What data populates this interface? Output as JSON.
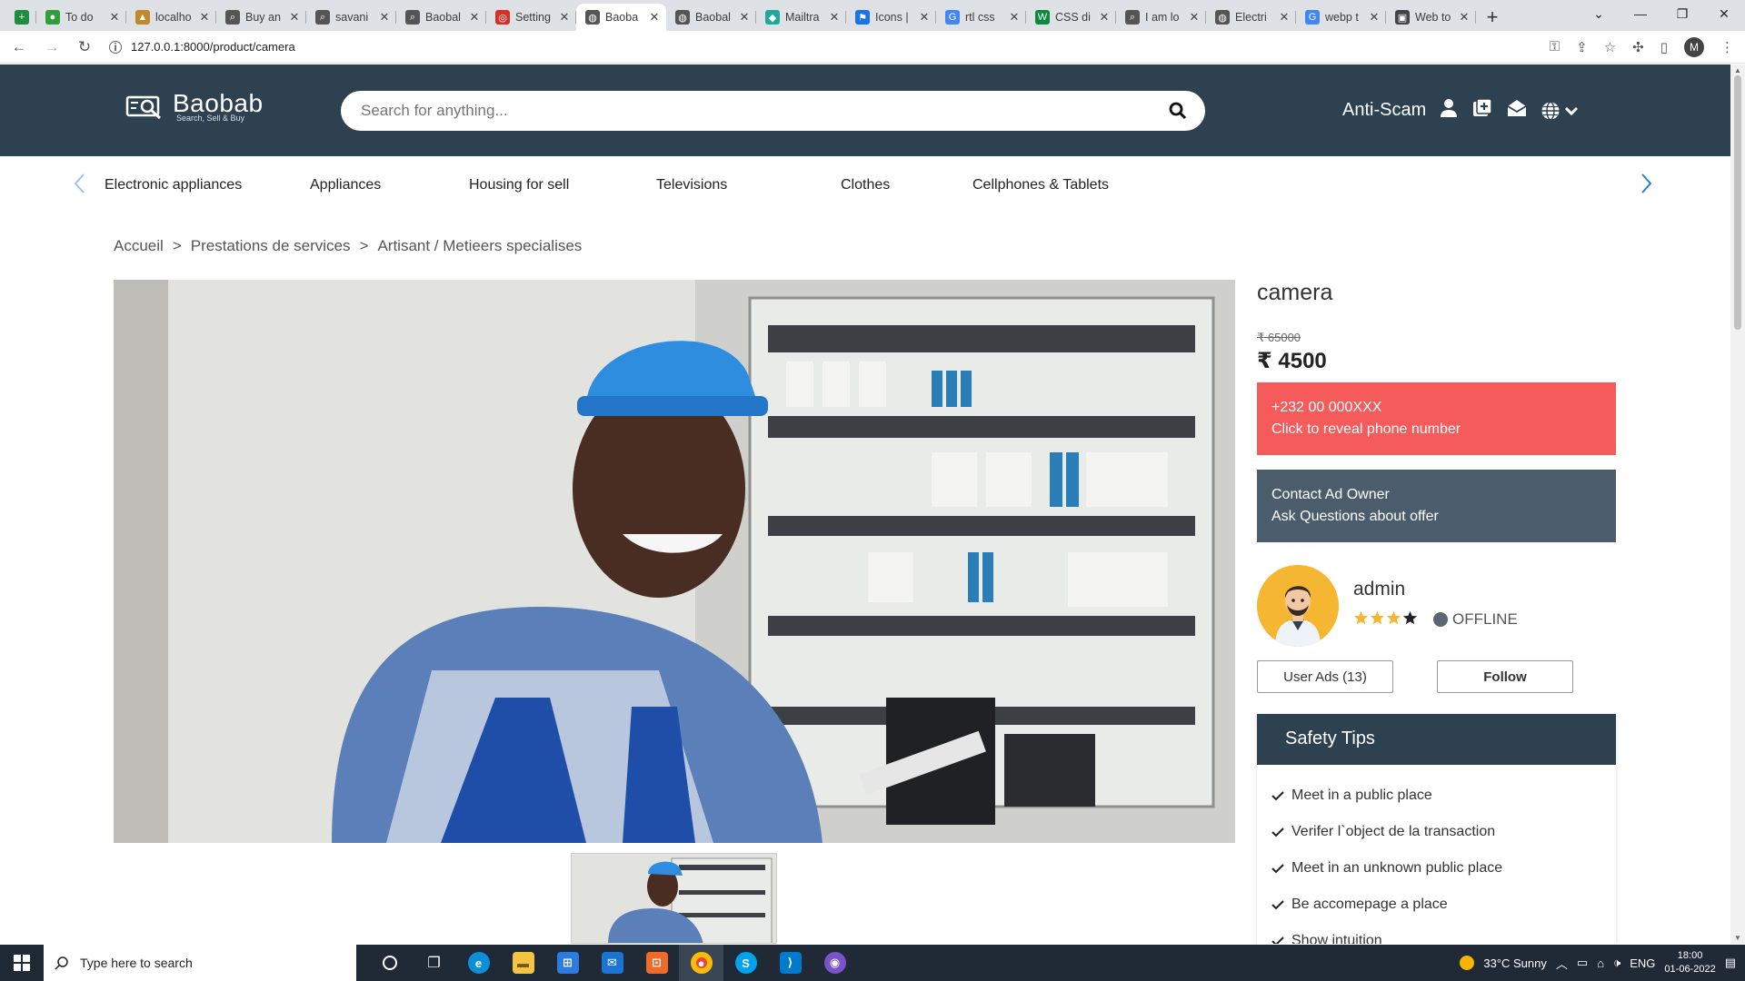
{
  "browser": {
    "tabs": [
      {
        "title": "",
        "favicon_color": "#1e8e3e",
        "favicon_glyph": "+",
        "favicon_name": "sheets-icon"
      },
      {
        "title": "To do",
        "favicon_color": "#2e9f3a",
        "favicon_glyph": "●",
        "favicon_name": "evernote-icon"
      },
      {
        "title": "localho",
        "favicon_color": "#c08a2a",
        "favicon_glyph": "▲",
        "favicon_name": "localhost-icon"
      },
      {
        "title": "Buy an",
        "favicon_color": "#555555",
        "favicon_glyph": "⌕",
        "favicon_name": "baobab-icon"
      },
      {
        "title": "savani",
        "favicon_color": "#555555",
        "favicon_glyph": "⌕",
        "favicon_name": "baobab-icon"
      },
      {
        "title": "Baobal",
        "favicon_color": "#555555",
        "favicon_glyph": "⌕",
        "favicon_name": "baobab-icon"
      },
      {
        "title": "Setting",
        "favicon_color": "#d93025",
        "favicon_glyph": "◎",
        "favicon_name": "settings-icon"
      },
      {
        "title": "Baoba",
        "favicon_color": "#555555",
        "favicon_glyph": "◍",
        "favicon_name": "globe-icon",
        "active": true
      },
      {
        "title": "Baobal",
        "favicon_color": "#555555",
        "favicon_glyph": "◍",
        "favicon_name": "globe-icon"
      },
      {
        "title": "Mailtra",
        "favicon_color": "#22a89a",
        "favicon_glyph": "◆",
        "favicon_name": "mailtrap-icon"
      },
      {
        "title": "Icons |",
        "favicon_color": "#1a73e8",
        "favicon_glyph": "⚑",
        "favicon_name": "flag-icon"
      },
      {
        "title": "rtl css",
        "favicon_color": "#4285f4",
        "favicon_glyph": "G",
        "favicon_name": "google-icon"
      },
      {
        "title": "CSS di",
        "favicon_color": "#0a8a3a",
        "favicon_glyph": "W",
        "favicon_name": "w3schools-icon"
      },
      {
        "title": "I am lo",
        "favicon_color": "#555555",
        "favicon_glyph": "⌕",
        "favicon_name": "baobab-icon"
      },
      {
        "title": "Electri",
        "favicon_color": "#555555",
        "favicon_glyph": "◍",
        "favicon_name": "globe-icon"
      },
      {
        "title": "webp t",
        "favicon_color": "#4285f4",
        "favicon_glyph": "G",
        "favicon_name": "google-icon"
      },
      {
        "title": "Web to",
        "favicon_color": "#444444",
        "favicon_glyph": "▣",
        "favicon_name": "web-icon"
      }
    ],
    "url": "127.0.0.1:8000/product/camera",
    "profile_initial": "M"
  },
  "header": {
    "brand": "Baobab",
    "tagline": "Search, Sell & Buy",
    "search_placeholder": "Search for anything...",
    "anti_scam": "Anti-Scam"
  },
  "categories": [
    "Electronic appliances",
    "Appliances",
    "Housing for sell",
    "Televisions",
    "Clothes",
    "Cellphones & Tablets"
  ],
  "breadcrumb": {
    "items": [
      "Accueil",
      "Prestations de services",
      "Artisant / Metieers specialises"
    ],
    "separator": ">"
  },
  "product": {
    "title": "camera",
    "old_price": "₹ 65000",
    "price": "₹ 4500"
  },
  "phone_button": {
    "line1": "+232 00 000XXX",
    "line2": "Click to reveal phone number",
    "color": "#f55b5b"
  },
  "contact_button": {
    "line1": "Contact Ad Owner",
    "line2": "Ask Questions about offer",
    "color": "#4b5d6c"
  },
  "seller": {
    "name": "admin",
    "rating": 3,
    "rating_max": 4,
    "status": "OFFLINE",
    "user_ads_label": "User Ads (13)",
    "follow_label": "Follow"
  },
  "safety": {
    "title": "Safety Tips",
    "tips": [
      "Meet in a public place",
      "Verifer l`object de la transaction",
      "Meet in an unknown public place",
      "Be accomepage a place",
      "Show intuition"
    ]
  },
  "taskbar": {
    "search_placeholder": "Type here to search",
    "weather": "33°C  Sunny",
    "lang": "ENG",
    "time": "18:00",
    "date": "01-06-2022"
  },
  "colors": {
    "header_bg": "#2e4150",
    "accent_blue": "#2a7dd1",
    "star": "#f5b731"
  }
}
